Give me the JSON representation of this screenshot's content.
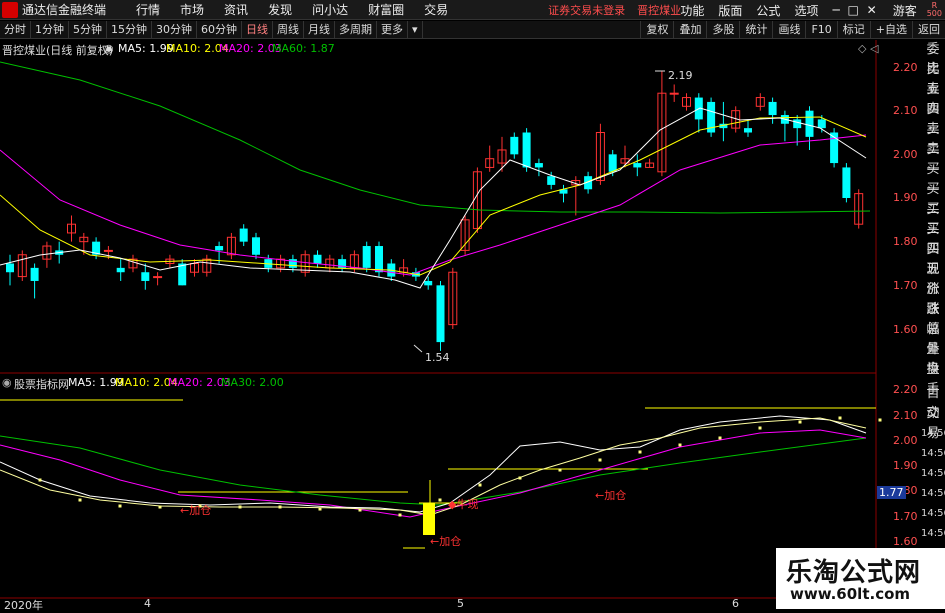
{
  "app_title": "通达信金融终端",
  "menu": [
    "行情",
    "市场",
    "资讯",
    "发现",
    "问小达",
    "财富圈",
    "交易"
  ],
  "login_text": "证券交易未登录",
  "stock_name_top": "晋控煤业",
  "menu_right": [
    "功能",
    "版面",
    "公式",
    "选项",
    "游客"
  ],
  "badge": "R\n500",
  "period_tabs": [
    "分时",
    "1分钟",
    "5分钟",
    "15分钟",
    "30分钟",
    "60分钟",
    "日线",
    "周线",
    "月线",
    "多周期",
    "更多"
  ],
  "active_tab": "日线",
  "tools": [
    "复权",
    "叠加",
    "多股",
    "统计",
    "画线",
    "F10",
    "标记",
    "+自选",
    "返回"
  ],
  "main_header": {
    "title": "晋控煤业(日线 前复权)",
    "ma5": "MA5: 1.99",
    "ma10": "MA10: 2.04",
    "ma20": "MA20: 2.03",
    "ma60": "MA60: 1.87"
  },
  "main_axis": [
    "2.20",
    "2.10",
    "2.00",
    "1.90",
    "1.80",
    "1.70",
    "1.60"
  ],
  "high_label": "2.19",
  "low_label": "1.54",
  "sub_header": {
    "title": "股票指标网",
    "ma5": "MA5: 1.99",
    "ma10": "MA10: 2.04",
    "ma20": "MA20: 2.03",
    "ma30": "MA30: 2.00"
  },
  "sub_axis": [
    "2.20",
    "2.10",
    "2.00",
    "1.90",
    "1.80",
    "1.77",
    "1.70",
    "1.60"
  ],
  "sub_labels": {
    "add1": "加仓",
    "add2": "加仓",
    "add3": "加仓",
    "bull": "牛现"
  },
  "side_panel": [
    "委比",
    "卖五",
    "卖四",
    "卖三",
    "卖二",
    "卖一",
    "买一",
    "买二",
    "买三",
    "买四",
    "买五",
    "现价",
    "涨跌",
    "涨幅",
    "总量",
    "外盘",
    "换手",
    "净资",
    "收益"
  ],
  "side_panel2": [
    "自动",
    "交易",
    "14:56",
    "14:56",
    "14:56",
    "14:56",
    "14:56",
    "14:56",
    "14:56",
    "14:56"
  ],
  "date_labels": [
    "2020年",
    "4",
    "5",
    "6"
  ],
  "watermark": {
    "big": "乐淘公式网",
    "small": "www.60lt.com"
  },
  "colors": {
    "up": "#ff3232",
    "down": "#00ffff",
    "ma5": "#ffffff",
    "ma10": "#ffff00",
    "ma20": "#ff00ff",
    "ma60": "#00c000"
  }
}
